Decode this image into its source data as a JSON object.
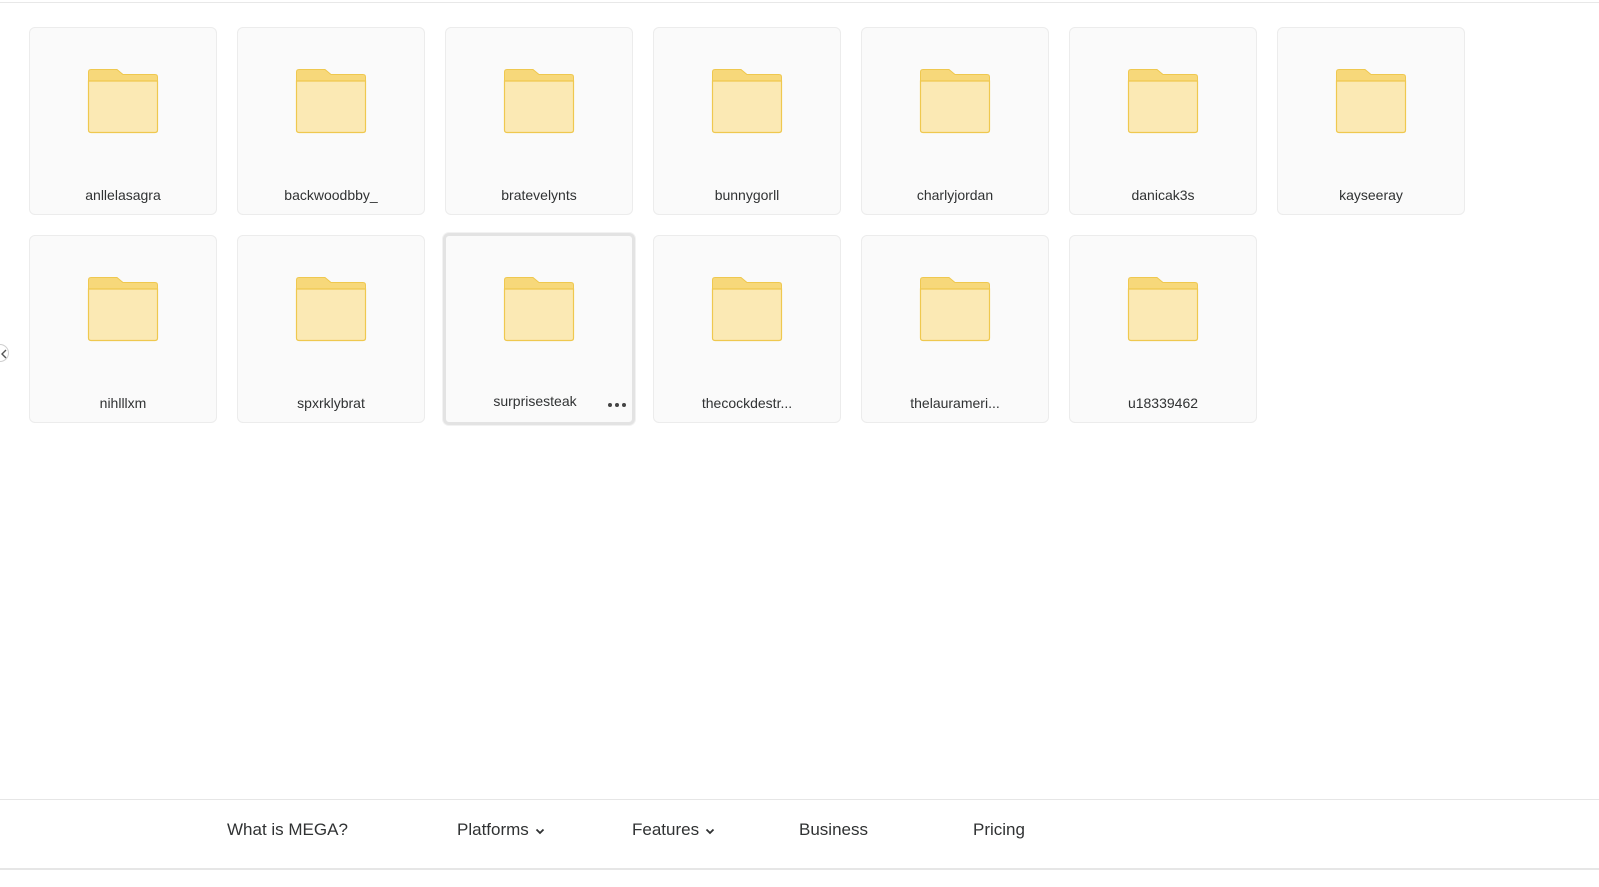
{
  "folders": [
    {
      "name": "anllelasagra"
    },
    {
      "name": "backwoodbby_"
    },
    {
      "name": "bratevelynts"
    },
    {
      "name": "bunnygorll"
    },
    {
      "name": "charlyjordan"
    },
    {
      "name": "danicak3s"
    },
    {
      "name": "kayseeray"
    },
    {
      "name": "nihlllxm"
    },
    {
      "name": "spxrklybrat"
    },
    {
      "name": "surprisesteak",
      "selected": true
    },
    {
      "name": "thecockdestr..."
    },
    {
      "name": "thelaurameri..."
    },
    {
      "name": "u18339462"
    }
  ],
  "nav": {
    "what_is": "What is MEGA?",
    "platforms": "Platforms",
    "features": "Features",
    "business": "Business",
    "pricing": "Pricing"
  },
  "colors": {
    "folder_fill": "#FBE9B4",
    "folder_tab": "#F7D87A",
    "folder_stroke": "#EFC84F",
    "tile_bg": "#FAFAFA"
  },
  "icons": {
    "folder": "folder-icon",
    "more": "more-options-icon",
    "chevron": "chevron-down-icon",
    "collapse": "chevron-left-icon"
  }
}
